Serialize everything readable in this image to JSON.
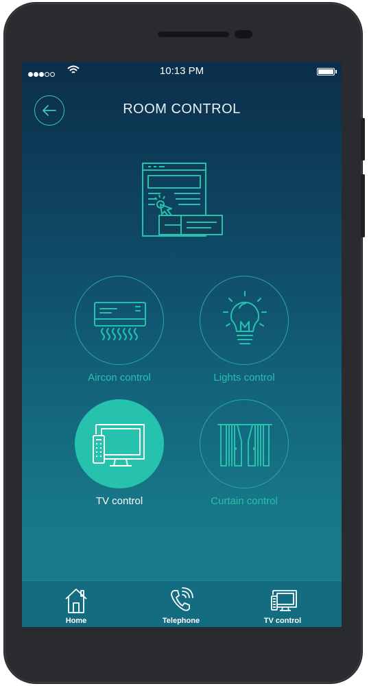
{
  "status_bar": {
    "time": "10:13 PM",
    "signal_bars_filled": 3,
    "signal_bars_total": 5,
    "battery_level": 1.0
  },
  "header": {
    "title": "ROOM CONTROL",
    "back_icon": "arrow-left-icon"
  },
  "hero_icon": "web-panel-click-icon",
  "controls": [
    {
      "label": "Aircon control",
      "icon": "air-conditioner-icon",
      "active": false
    },
    {
      "label": "Lights control",
      "icon": "light-bulb-icon",
      "active": false
    },
    {
      "label": "TV control",
      "icon": "tv-remote-icon",
      "active": true
    },
    {
      "label": "Curtain control",
      "icon": "curtain-icon",
      "active": false
    }
  ],
  "tabbar": {
    "items": [
      {
        "label": "Home",
        "icon": "home-icon"
      },
      {
        "label": "Telephone",
        "icon": "phone-icon"
      },
      {
        "label": "TV control",
        "icon": "tv-remote-icon"
      }
    ]
  },
  "colors": {
    "accent": "#27c2ad",
    "screen_top": "#0b2e4a",
    "screen_bottom": "#1a7e8d",
    "tabbar": "#146c80"
  }
}
